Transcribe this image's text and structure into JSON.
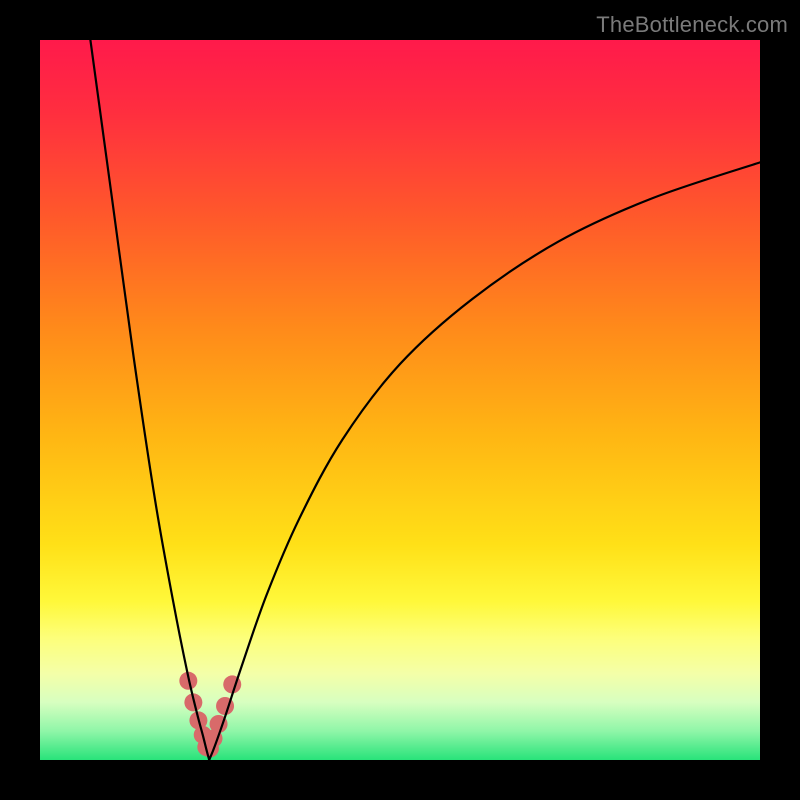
{
  "watermark": "TheBottleneck.com",
  "chart_data": {
    "type": "line",
    "title": "",
    "xlabel": "",
    "ylabel": "",
    "xlim": [
      0,
      100
    ],
    "ylim": [
      0,
      100
    ],
    "grid": false,
    "legend": false,
    "gradient_stops": [
      {
        "offset": 0.0,
        "color": "#ff1a4b"
      },
      {
        "offset": 0.1,
        "color": "#ff2e3f"
      },
      {
        "offset": 0.25,
        "color": "#ff5a2a"
      },
      {
        "offset": 0.4,
        "color": "#ff8a1a"
      },
      {
        "offset": 0.55,
        "color": "#ffb613"
      },
      {
        "offset": 0.7,
        "color": "#ffe017"
      },
      {
        "offset": 0.78,
        "color": "#fff83a"
      },
      {
        "offset": 0.83,
        "color": "#fdff7a"
      },
      {
        "offset": 0.88,
        "color": "#f4ffa8"
      },
      {
        "offset": 0.92,
        "color": "#d7ffc0"
      },
      {
        "offset": 0.96,
        "color": "#8ff6a8"
      },
      {
        "offset": 1.0,
        "color": "#28e37a"
      }
    ],
    "series": [
      {
        "name": "bottleneck-curve-left",
        "color": "#000000",
        "width": 2.2,
        "x": [
          7.0,
          10.0,
          13.0,
          16.0,
          18.5,
          20.5,
          21.8,
          22.6,
          23.1,
          23.5
        ],
        "y": [
          100.0,
          78.0,
          56.0,
          36.0,
          22.0,
          12.0,
          6.5,
          3.5,
          1.5,
          0.0
        ]
      },
      {
        "name": "bottleneck-curve-right",
        "color": "#000000",
        "width": 2.2,
        "x": [
          23.5,
          24.3,
          25.7,
          28.0,
          31.5,
          36.0,
          42.0,
          50.0,
          60.0,
          72.0,
          85.0,
          100.0
        ],
        "y": [
          0.0,
          2.0,
          6.0,
          13.0,
          23.0,
          33.5,
          44.5,
          55.0,
          64.0,
          72.0,
          78.0,
          83.0
        ]
      },
      {
        "name": "highlight-dots",
        "type": "scatter",
        "color": "#d86a6a",
        "radius": 9,
        "x": [
          20.6,
          21.3,
          22.0,
          22.6,
          23.1,
          23.6,
          24.1,
          24.8,
          25.7,
          26.7
        ],
        "y": [
          11.0,
          8.0,
          5.5,
          3.5,
          1.8,
          1.6,
          3.0,
          5.0,
          7.5,
          10.5
        ]
      }
    ]
  }
}
